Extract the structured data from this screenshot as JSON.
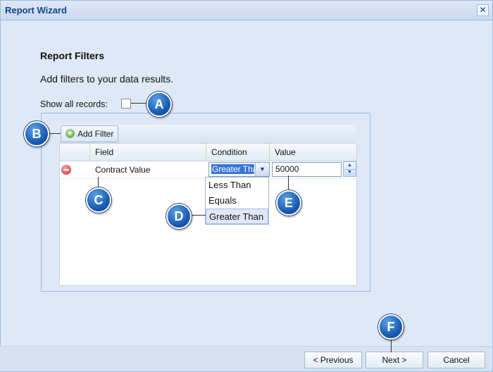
{
  "window": {
    "title": "Report Wizard",
    "close_glyph": "✕"
  },
  "page": {
    "heading": "Report Filters",
    "description": "Add filters to your data results.",
    "show_all_label": "Show all records:",
    "show_all_checked": false
  },
  "toolbar": {
    "add_filter_label": "Add Filter"
  },
  "grid": {
    "columns": [
      "Field",
      "Condition",
      "Value"
    ],
    "rows": [
      {
        "field": "Contract Value",
        "condition": "Greater Than",
        "value": "50000"
      }
    ]
  },
  "dropdown": {
    "options": [
      "Less Than",
      "Equals",
      "Greater Than"
    ],
    "selected": "Greater Than"
  },
  "footer": {
    "previous_label": "< Previous",
    "next_label": "Next >",
    "cancel_label": "Cancel"
  },
  "callouts": [
    "A",
    "B",
    "C",
    "D",
    "E",
    "F"
  ],
  "colors": {
    "accent": "#1a5db3",
    "title": "#15428b",
    "panel": "#dfe8f6",
    "selection": "#3875d7"
  }
}
